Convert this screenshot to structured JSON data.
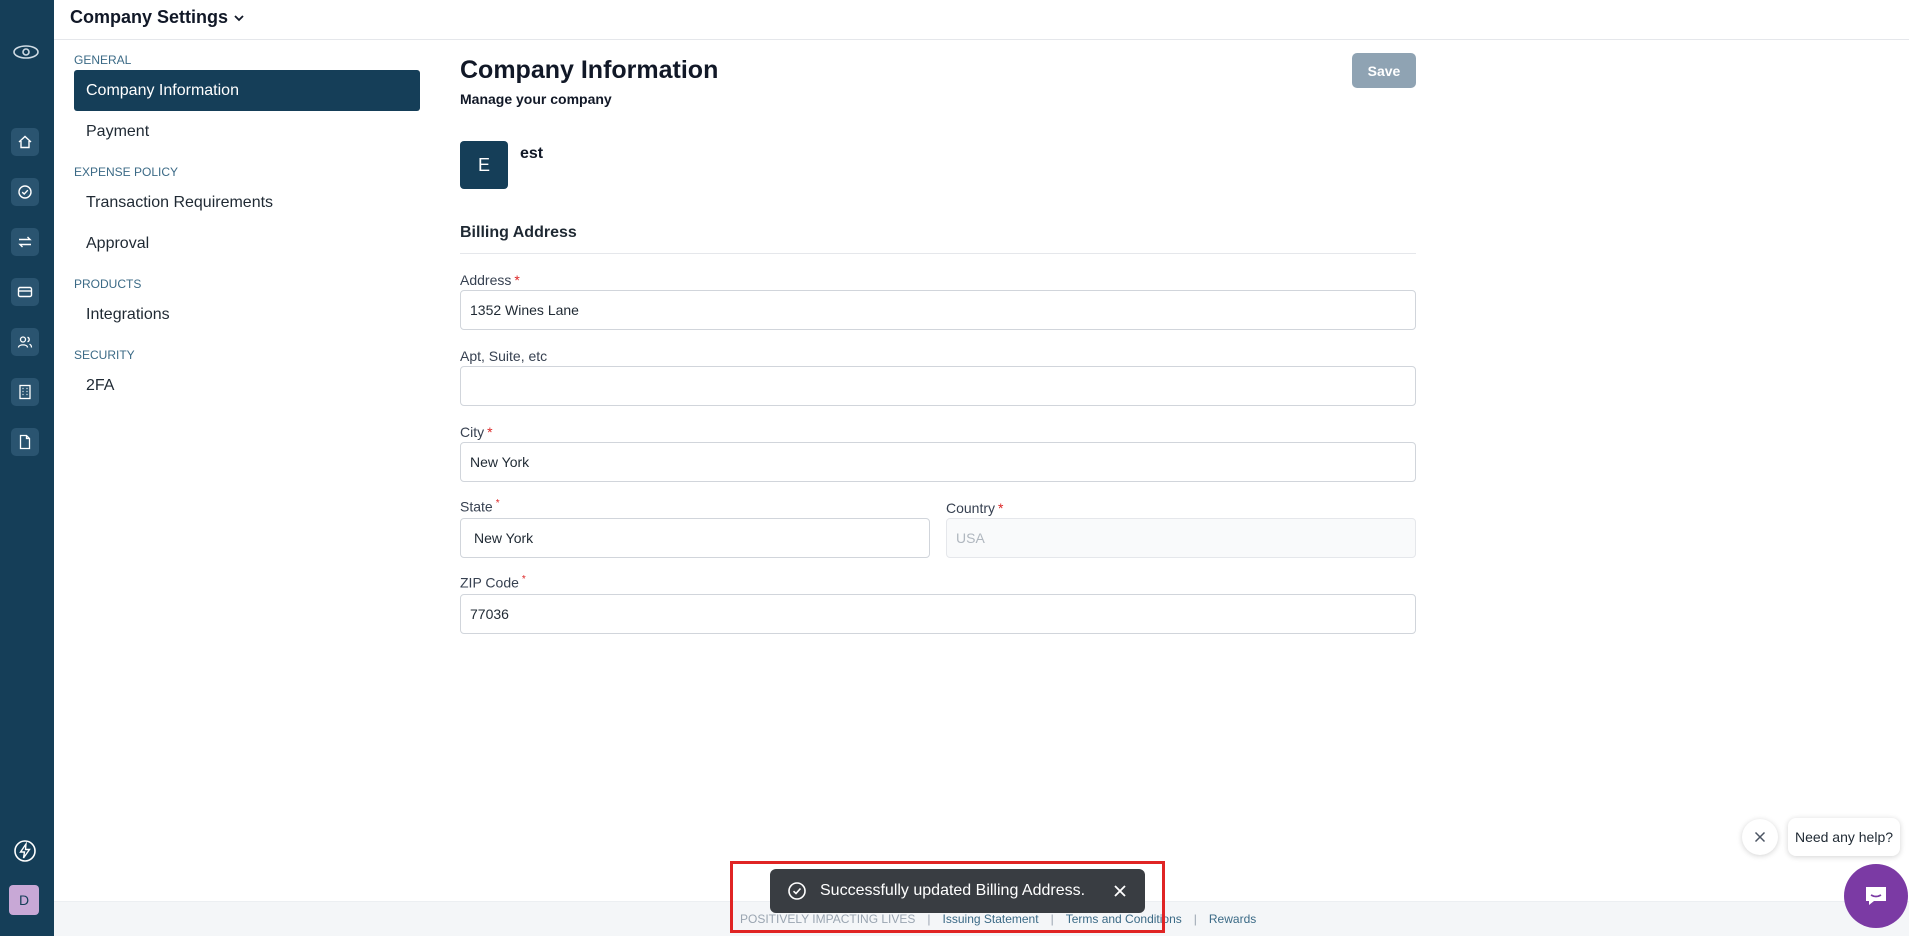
{
  "header": {
    "title": "Company Settings",
    "dropdown_icon": "chevron-down-icon"
  },
  "rail": {
    "logo_icon": "eye-logo-icon",
    "items": [
      {
        "icon": "home-icon"
      },
      {
        "icon": "check-circle-icon"
      },
      {
        "icon": "transfer-arrows-icon"
      },
      {
        "icon": "credit-card-icon"
      },
      {
        "icon": "users-icon"
      },
      {
        "icon": "building-icon"
      },
      {
        "icon": "document-icon"
      }
    ],
    "bottom_icon": "lightning-circle-icon",
    "avatar_initial": "D"
  },
  "sidebar": {
    "groups": [
      {
        "title": "GENERAL",
        "items": [
          {
            "label": "Company Information",
            "active": true
          },
          {
            "label": "Payment",
            "active": false
          }
        ]
      },
      {
        "title": "EXPENSE POLICY",
        "items": [
          {
            "label": "Transaction Requirements",
            "active": false
          },
          {
            "label": "Approval",
            "active": false
          }
        ]
      },
      {
        "title": "PRODUCTS",
        "items": [
          {
            "label": "Integrations",
            "active": false
          }
        ]
      },
      {
        "title": "SECURITY",
        "items": [
          {
            "label": "2FA",
            "active": false
          }
        ]
      }
    ]
  },
  "main": {
    "title": "Company Information",
    "subtitle": "Manage your company",
    "save_label": "Save",
    "company": {
      "initial": "E",
      "name": "est"
    },
    "billing": {
      "title": "Billing Address",
      "address": {
        "label": "Address",
        "required": "*",
        "value": "1352 Wines Lane"
      },
      "apt": {
        "label": "Apt, Suite, etc",
        "value": ""
      },
      "city": {
        "label": "City",
        "required": "*",
        "value": "New York"
      },
      "state": {
        "label": "State",
        "required": "*",
        "value": "New York"
      },
      "country": {
        "label": "Country",
        "required": "*",
        "value": "USA"
      },
      "zip": {
        "label": "ZIP Code",
        "required": "*",
        "value": "77036"
      }
    }
  },
  "toast": {
    "icon": "check-circle-icon",
    "message": "Successfully updated Billing Address.",
    "close_icon": "close-icon"
  },
  "footer": {
    "tagline": "POSITIVELY IMPACTING LIVES",
    "separator": "|",
    "links": [
      "Issuing Statement",
      "Terms and Conditions",
      "Rewards"
    ]
  },
  "help": {
    "bubble_text": "Need any help?",
    "close_icon": "close-icon",
    "fab_icon": "chat-icon"
  },
  "colors": {
    "brand": "#153e58",
    "toast_bg": "#393d42",
    "help_fab": "#7b3aa4",
    "required": "#dc2626",
    "highlight": "#e02424"
  }
}
